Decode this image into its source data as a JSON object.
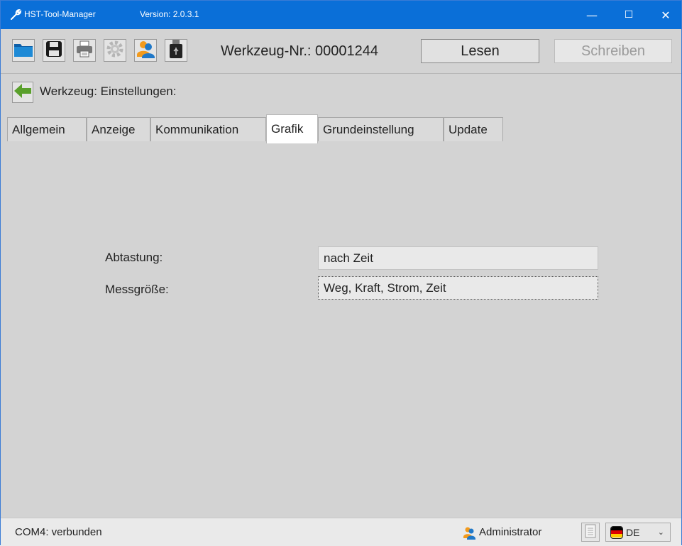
{
  "window": {
    "title": "HST-Tool-Manager",
    "version": "Version: 2.0.3.1",
    "minimize_glyph": "—",
    "maximize_glyph": "☐",
    "close_glyph": "✕"
  },
  "toolbar": {
    "tool_label": "Werkzeug-Nr.: 00001244",
    "read_label": "Lesen",
    "write_label": "Schreiben",
    "icons": [
      "folder-icon",
      "save-icon",
      "printer-icon",
      "gear-icon",
      "user-icon",
      "usb-icon"
    ]
  },
  "breadcrumb": {
    "text": "Werkzeug: Einstellungen:"
  },
  "tabs": [
    {
      "label": "Allgemein",
      "active": false
    },
    {
      "label": "Anzeige",
      "active": false
    },
    {
      "label": "Kommunikation",
      "active": false
    },
    {
      "label": "Grafik",
      "active": true
    },
    {
      "label": "Grundeinstellung",
      "active": false
    },
    {
      "label": "Update",
      "active": false
    }
  ],
  "form": {
    "sampling_label": "Abtastung:",
    "sampling_value": "nach Zeit",
    "measure_label": "Messgröße:",
    "measure_value": "Weg, Kraft, Strom, Zeit"
  },
  "status": {
    "connection": "COM4: verbunden",
    "user": "Administrator",
    "language": "DE"
  },
  "colors": {
    "titlebar": "#0a6fd8",
    "background": "#d3d3d3",
    "statusbar": "#eaeaea"
  }
}
